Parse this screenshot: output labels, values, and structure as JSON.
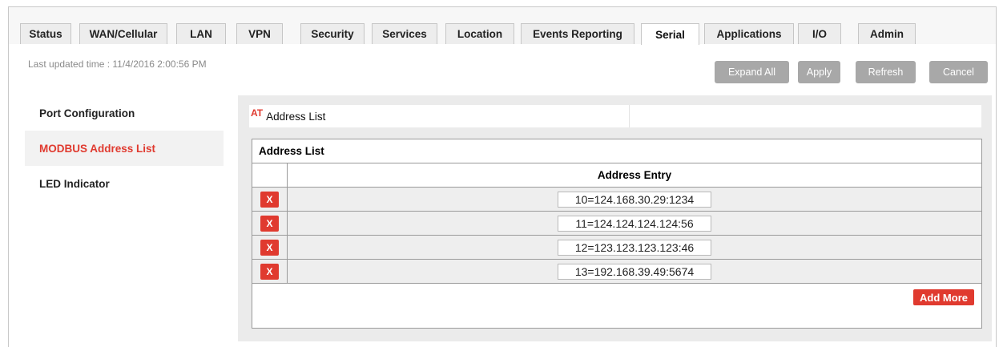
{
  "tabs": [
    {
      "label": "Status",
      "active": false
    },
    {
      "label": "WAN/Cellular",
      "active": false
    },
    {
      "label": "LAN",
      "active": false
    },
    {
      "label": "VPN",
      "active": false
    },
    {
      "label": "Security",
      "active": false
    },
    {
      "label": "Services",
      "active": false
    },
    {
      "label": "Location",
      "active": false
    },
    {
      "label": "Events Reporting",
      "active": false
    },
    {
      "label": "Serial",
      "active": true
    },
    {
      "label": "Applications",
      "active": false
    },
    {
      "label": "I/O",
      "active": false
    },
    {
      "label": "Admin",
      "active": false
    }
  ],
  "header": {
    "last_updated": "Last updated time : 11/4/2016 2:00:56 PM",
    "buttons": {
      "expand_all": "Expand All",
      "apply": "Apply",
      "refresh": "Refresh",
      "cancel": "Cancel"
    }
  },
  "sidebar": {
    "items": [
      {
        "label": "Port Configuration",
        "active": false
      },
      {
        "label": "MODBUS Address List",
        "active": true
      },
      {
        "label": "LED Indicator",
        "active": false
      }
    ]
  },
  "main": {
    "at_label": "AT",
    "at_text": "Address List",
    "list_title": "Address List",
    "column_header": "Address Entry",
    "delete_label": "X",
    "entries": [
      "10=124.168.30.29:1234",
      "11=124.124.124.124:56",
      "12=123.123.123.123:46",
      "13=192.168.39.49:5674"
    ],
    "add_more": "Add More"
  },
  "colors": {
    "accent": "#e03a2f",
    "button_gray": "#a8a8a8",
    "panel_bg": "#ebebeb"
  }
}
